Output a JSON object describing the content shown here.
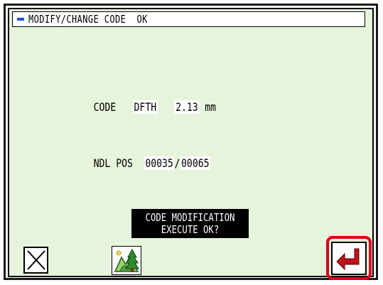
{
  "title": "MODIFY/CHANGE CODE  OK",
  "code": {
    "label": "CODE",
    "name": "DFTH",
    "value": "2.13",
    "unit": "mm"
  },
  "needle_position": {
    "label": "NDL POS",
    "current": "00035",
    "separator": "/",
    "total": "00065"
  },
  "prompt": {
    "line1": "CODE MODIFICATION",
    "line2": "EXECUTE OK?"
  },
  "buttons": {
    "cancel_icon": "close-x-icon",
    "image_icon": "landscape-tree-icon",
    "enter_icon": "enter-return-icon"
  },
  "colors": {
    "screen_bg": "#e6f4dc",
    "highlight": "#e0001a",
    "enter_arrow": "#c0101a",
    "title_mark": "#2050e0"
  }
}
